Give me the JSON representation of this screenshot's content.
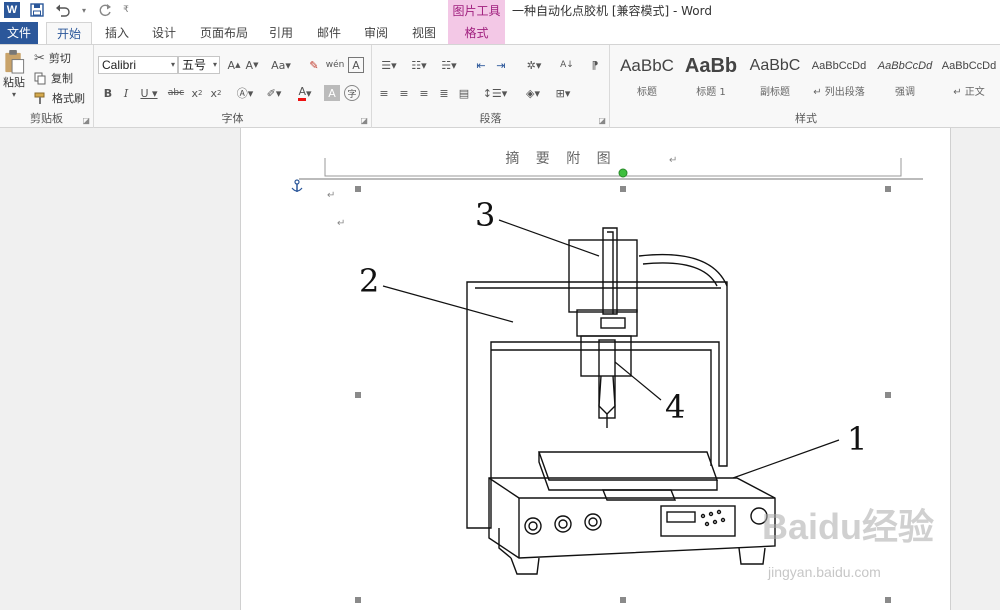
{
  "titlebar": {
    "app_logo": "W",
    "save_icon": "save-icon",
    "undo_icon": "undo-icon",
    "redo_icon": "redo-icon",
    "context_tools": "图片工具",
    "doc_title": "一种自动化点胶机 [兼容模式] - Word"
  },
  "tabs": [
    "文件",
    "开始",
    "插入",
    "设计",
    "页面布局",
    "引用",
    "邮件",
    "审阅",
    "视图",
    "格式"
  ],
  "ribbon": {
    "clipboard": {
      "paste": "粘贴",
      "cut": "剪切",
      "copy": "复制",
      "format_painter": "格式刷",
      "label": "剪贴板"
    },
    "font": {
      "name": "Calibri",
      "size": "五号",
      "label": "字体"
    },
    "paragraph": {
      "label": "段落"
    },
    "styles": {
      "label": "样式",
      "items": [
        {
          "sample": "AaBbC",
          "name": "标题"
        },
        {
          "sample": "AaBb",
          "name": "标题 1"
        },
        {
          "sample": "AaBbC",
          "name": "副标题"
        },
        {
          "sample": "AaBbCcDd",
          "name": "↵ 列出段落"
        },
        {
          "sample": "AaBbCcDd",
          "name": "强调"
        },
        {
          "sample": "AaBbCcDd",
          "name": "↵ 正文"
        }
      ]
    }
  },
  "document": {
    "header_text": "摘 要 附 图",
    "callouts": [
      "1",
      "2",
      "3",
      "4"
    ]
  },
  "watermark": {
    "brand": "Baidu经验",
    "url": "jingyan.baidu.com"
  },
  "colors": {
    "word_blue": "#2b579a",
    "picture_tools_pink": "#f3c8e6",
    "picture_tools_text": "#a01f7e"
  }
}
